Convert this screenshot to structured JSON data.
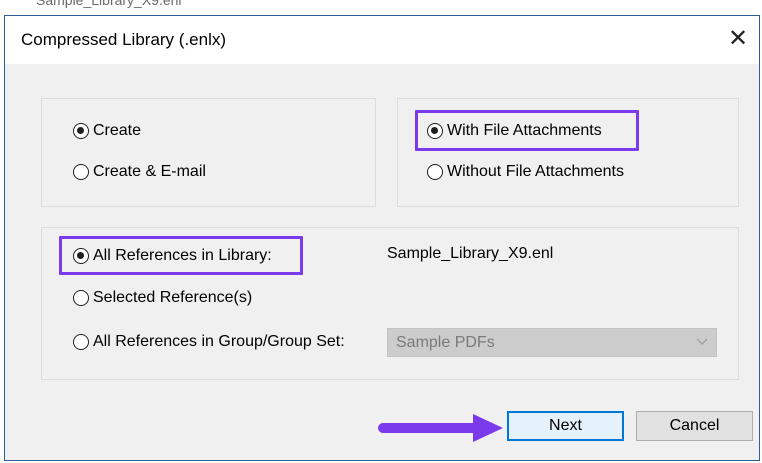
{
  "background_text": "Sample_Library_X9.enl",
  "dialog": {
    "title": "Compressed Library (.enlx)",
    "close_glyph": "✕"
  },
  "action_group": {
    "options": [
      {
        "label": "Create",
        "selected": true
      },
      {
        "label": "Create & E-mail",
        "selected": false
      }
    ]
  },
  "attachments_group": {
    "options": [
      {
        "label": "With File Attachments",
        "selected": true,
        "highlighted": true
      },
      {
        "label": "Without File Attachments",
        "selected": false
      }
    ]
  },
  "references_group": {
    "options": [
      {
        "label": "All References in Library:",
        "selected": true,
        "highlighted": true
      },
      {
        "label": "Selected Reference(s)",
        "selected": false
      },
      {
        "label": "All References in Group/Group Set:",
        "selected": false
      }
    ],
    "library_name": "Sample_Library_X9.enl",
    "group_select": {
      "value": "Sample PDFs",
      "enabled": false
    }
  },
  "buttons": {
    "next": "Next",
    "cancel": "Cancel"
  },
  "colors": {
    "highlight": "#7c3aed",
    "arrow": "#7c3aed",
    "focus_border": "#0078d7"
  },
  "icons": {
    "close": "close-icon",
    "chevron": "chevron-down-icon",
    "pointer": "arrow-right-icon"
  }
}
